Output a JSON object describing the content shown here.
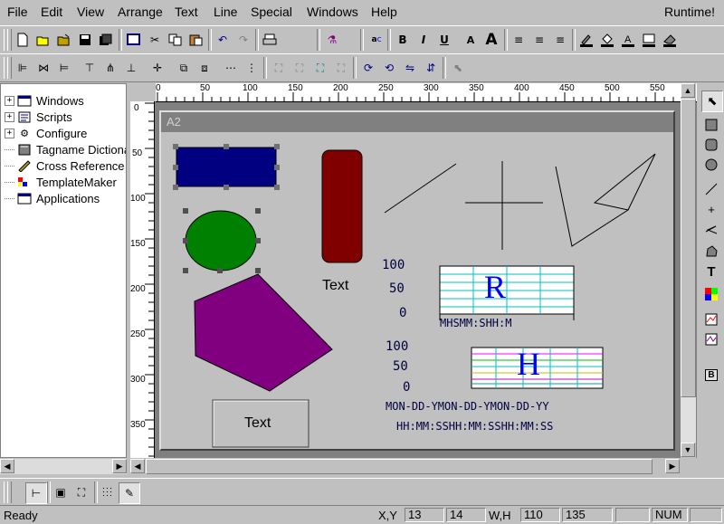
{
  "menu": {
    "items": [
      "File",
      "Edit",
      "View",
      "Arrange",
      "Text",
      "Line",
      "Special",
      "Windows",
      "Help"
    ],
    "runtime_label": "Runtime!"
  },
  "toolbar1": {
    "buttons": [
      "new-icon",
      "open-icon",
      "open-folder-icon",
      "save-icon",
      "save-all-icon",
      "window-icon",
      "cut-icon",
      "copy-icon",
      "paste-icon",
      "undo-icon",
      "redo-icon",
      "print-icon",
      "wizard-icon",
      "abc-spell-icon",
      "bold-icon",
      "italic-icon",
      "underline-icon",
      "font-smaller-icon",
      "font-larger-icon",
      "align-left-icon",
      "align-center-icon",
      "align-right-icon",
      "line-color-icon",
      "fill-color-icon",
      "text-color-icon",
      "window-color-icon",
      "eraser-icon"
    ],
    "bold_label": "B",
    "italic_label": "I",
    "underline_label": "U",
    "font_small_label": "A",
    "font_large_label": "A"
  },
  "tree": {
    "items": [
      {
        "label": "Windows",
        "expander": "+",
        "icon": "window-icon"
      },
      {
        "label": "Scripts",
        "expander": "+",
        "icon": "script-icon"
      },
      {
        "label": "Configure",
        "expander": "+",
        "icon": "configure-icon"
      },
      {
        "label": "Tagname Dictionary",
        "expander": "",
        "icon": "dictionary-icon"
      },
      {
        "label": "Cross Reference",
        "expander": "",
        "icon": "cross-reference-icon"
      },
      {
        "label": "TemplateMaker",
        "expander": "",
        "icon": "templatemaker-icon"
      },
      {
        "label": "Applications",
        "expander": "",
        "icon": "applications-icon"
      }
    ]
  },
  "ruler": {
    "top_labels": [
      "0",
      "50",
      "100",
      "150",
      "200",
      "250",
      "300",
      "350",
      "400",
      "450",
      "500",
      "550"
    ],
    "left_labels": [
      "0",
      "50",
      "100",
      "150",
      "200",
      "250",
      "300",
      "350"
    ]
  },
  "canvas_window": {
    "title": "A2",
    "rounded_rect_text": "Text",
    "button_text": "Text",
    "trend1": {
      "y_labels": [
        "100",
        "50",
        "0"
      ],
      "big_letter": "R",
      "time_label": "MHSMM:SHH:M"
    },
    "trend2": {
      "y_labels": [
        "100",
        "50",
        "0"
      ],
      "big_letter": "H",
      "date_label": "MON-DD-YMON-DD-YMON-DD-YY",
      "time_label": "HH:MM:SSHH:MM:SSHH:MM:SS"
    }
  },
  "colors": {
    "rect_fill": "#000080",
    "rounded_rect_fill": "#800000",
    "ellipse_fill": "#008000",
    "polygon_fill": "#800080",
    "trend_letter": "#0000ff",
    "grid_line": "#00c0c0"
  },
  "palette": {
    "tools": [
      "pointer-icon",
      "rectangle-icon",
      "rounded-rectangle-icon",
      "ellipse-icon",
      "line-icon",
      "hv-line-icon",
      "polyline-icon",
      "polygon-icon",
      "text-tool-icon",
      "bitmap-icon",
      "realtime-trend-icon",
      "historical-trend-icon",
      "button-tool-icon"
    ],
    "text_label": "T",
    "button_label": "B"
  },
  "status": {
    "ready": "Ready",
    "xy_label": "X,Y",
    "x": "13",
    "y": "14",
    "wh_label": "W,H",
    "w": "110",
    "h": "135",
    "num": "NUM"
  }
}
